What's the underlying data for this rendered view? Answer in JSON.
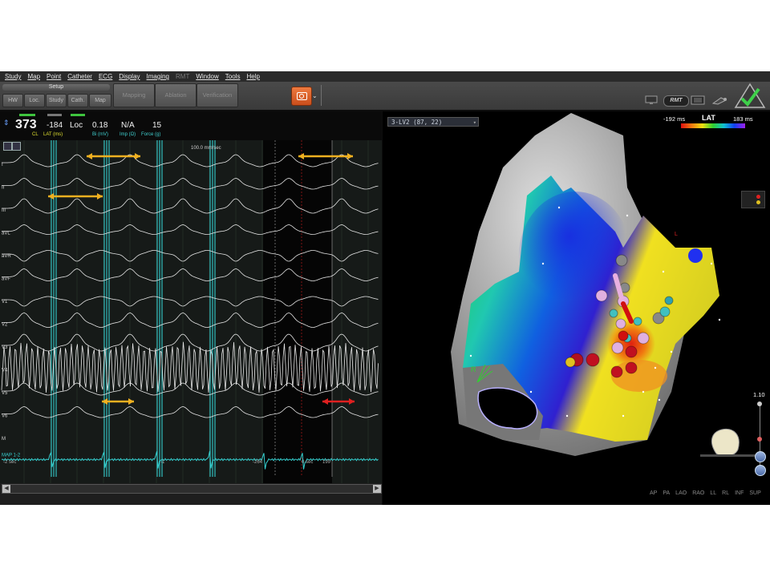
{
  "menu": [
    "Study",
    "Map",
    "Point",
    "Catheter",
    "ECG",
    "Display",
    "Imaging",
    "RMT",
    "Window",
    "Tools",
    "Help"
  ],
  "menu_disabled": [
    "RMT"
  ],
  "toolbar": {
    "setup_label": "Setup",
    "small_buttons": [
      "HW",
      "Loc.",
      "Study",
      "Cath.",
      "Map"
    ],
    "big_buttons": [
      "Mapping",
      "Ablation",
      "Verification"
    ],
    "camera_icon": "camera-icon",
    "status_icons": [
      "monitor-icon",
      "rmt-icon",
      "display-icon",
      "catheter-icon",
      "checkmark-icon"
    ],
    "rmt_label": "RMT"
  },
  "readout": {
    "cl_value": "373",
    "cl_label": "CL",
    "lat_value": "-184",
    "lat_label": "LAT (ms)",
    "loc_value": "Loc",
    "bi_value": "0.18",
    "bi_label": "Bi (mV)",
    "imp_value": "N/A",
    "imp_label": "Imp (Ω)",
    "force_value": "15",
    "force_label": "Force (g)"
  },
  "ecg": {
    "speed_label": "100.0 mm/sec",
    "leads": [
      "I",
      "II",
      "III",
      "aVL",
      "aVR",
      "aVF",
      "V1",
      "V2",
      "V3",
      "V4",
      "V5",
      "V6",
      "M",
      "MAP 1-2"
    ],
    "bottom_labels": [
      "-2 sec",
      "-1",
      "-264",
      "0 sec",
      "199"
    ],
    "colors": {
      "trace": "#e6e6e6",
      "map": "#36d0d0",
      "marker": "#36d0d0",
      "arrow_yellow": "#f0b020",
      "arrow_red": "#e02020"
    }
  },
  "map": {
    "selector_label": "3-LV2 (87, 22)",
    "lat_min": "-192 ms",
    "lat_title": "LAT",
    "lat_max": "183 ms",
    "zoom_value": "1.10",
    "views": [
      "AP",
      "PA",
      "LAO",
      "RAO",
      "LL",
      "RL",
      "INF",
      "SUP"
    ],
    "label_r": "R",
    "label_l": "L"
  }
}
